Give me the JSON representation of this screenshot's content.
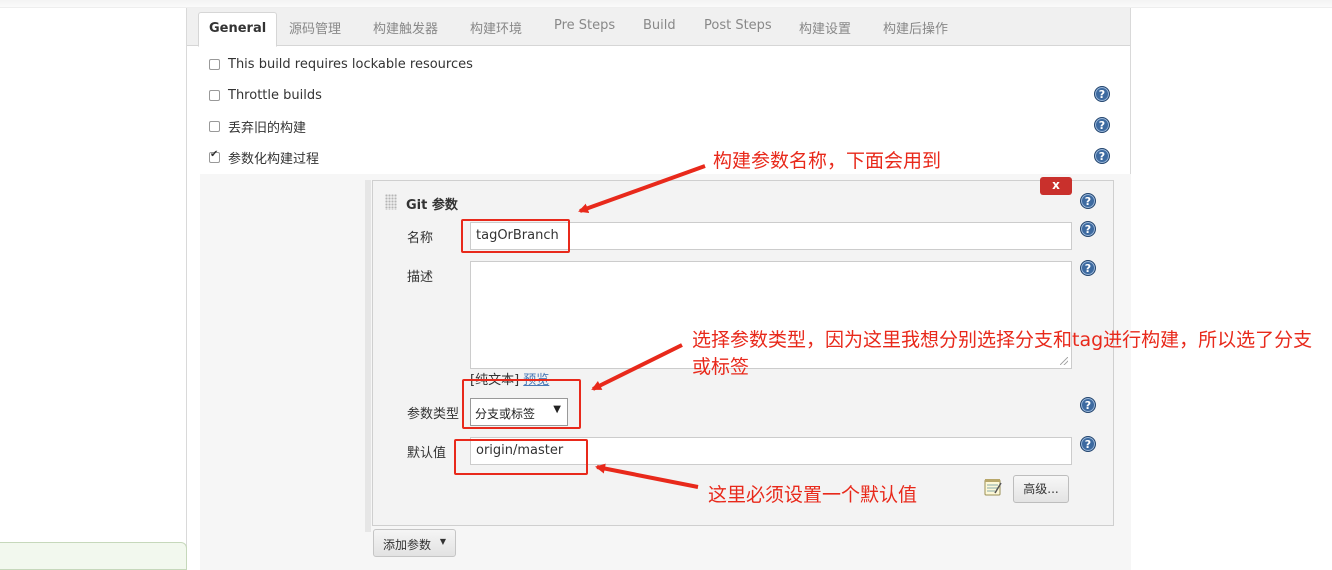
{
  "tabs": [
    "General",
    "源码管理",
    "构建触发器",
    "构建环境",
    "Pre Steps",
    "Build",
    "Post Steps",
    "构建设置",
    "构建后操作"
  ],
  "options": [
    {
      "label": "This build requires lockable resources",
      "checked": false
    },
    {
      "label": "Throttle builds",
      "checked": false
    },
    {
      "label": "丢弃旧的构建",
      "checked": false
    },
    {
      "label": "参数化构建过程",
      "checked": true
    }
  ],
  "param": {
    "title": "Git 参数",
    "delete_label": "x",
    "name_label": "名称",
    "name_value": "tagOrBranch",
    "desc_label": "描述",
    "desc_value": "",
    "plain_text_link": "[纯文本]",
    "preview_link": "预览",
    "type_label": "参数类型",
    "type_value": "分支或标签",
    "default_label": "默认值",
    "default_value": "origin/master",
    "advanced_label": "高级..."
  },
  "add_param_label": "添加参数",
  "help_glyph": "?",
  "annotations": {
    "name_note": "构建参数名称，下面会用到",
    "type_note": "选择参数类型，因为这里我想分别选择分支和tag进行构建，所以选了分支或标签",
    "default_note": "这里必须设置一个默认值"
  },
  "colors": {
    "annotation": "#e8291b",
    "help": "#3d6aa0",
    "link": "#4a7ab7",
    "delete": "#c9302c"
  }
}
